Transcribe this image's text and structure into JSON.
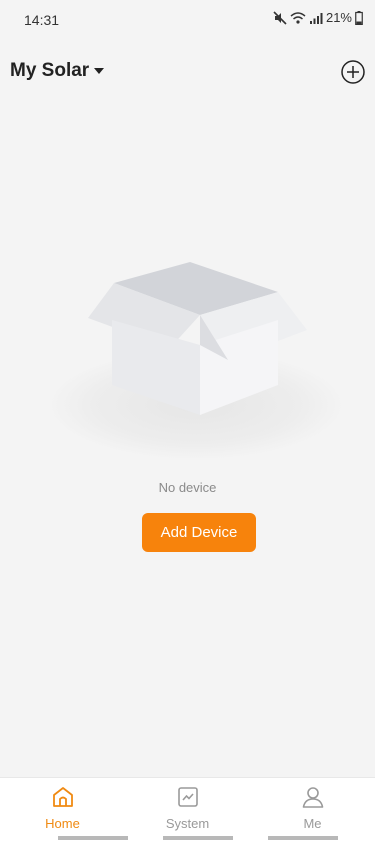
{
  "status_bar": {
    "time": "14:31",
    "battery_text": "21%",
    "icons": [
      "mute-icon",
      "wifi-icon",
      "signal-icon",
      "battery-icon"
    ]
  },
  "header": {
    "title": "My Solar",
    "dropdown_icon": "caret-down-icon",
    "add_icon": "plus-circle-icon"
  },
  "empty_state": {
    "illustration": "empty-box-illustration",
    "message": "No device",
    "button_label": "Add Device"
  },
  "bottom_nav": {
    "items": [
      {
        "label": "Home",
        "icon": "home-icon",
        "active": true
      },
      {
        "label": "System",
        "icon": "chart-icon",
        "active": false
      },
      {
        "label": "Me",
        "icon": "user-icon",
        "active": false
      }
    ]
  },
  "colors": {
    "accent": "#f7830c",
    "active_nav": "#f08a12",
    "background": "#f4f4f4",
    "inactive_nav": "#9a9a9a"
  }
}
